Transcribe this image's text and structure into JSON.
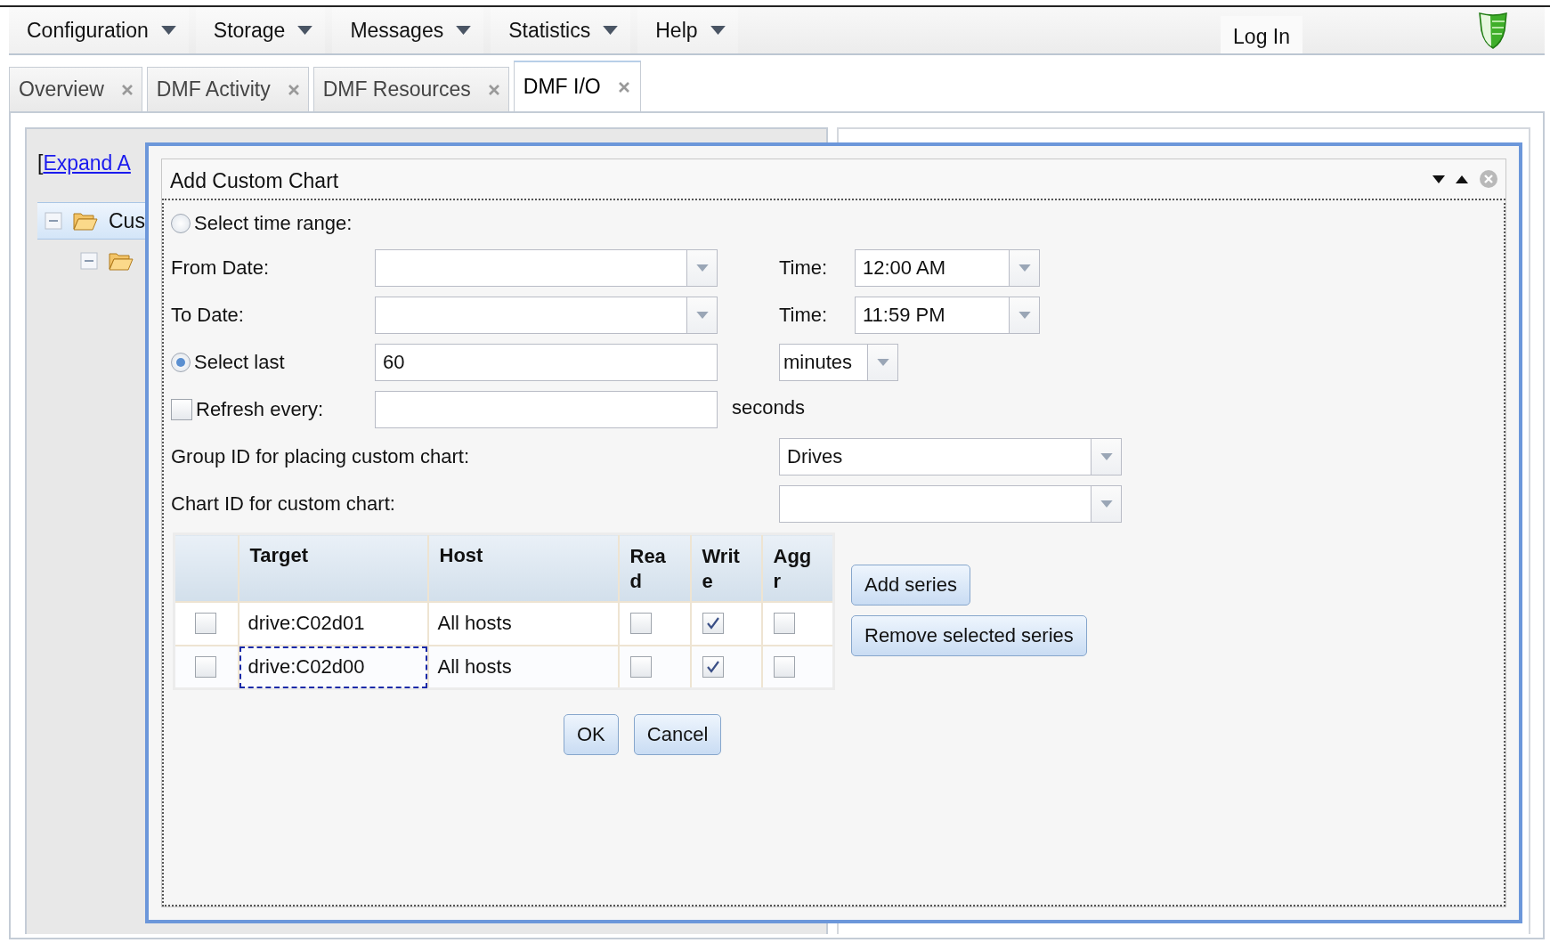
{
  "menubar": {
    "menus": [
      {
        "label": "Configuration"
      },
      {
        "label": "Storage"
      },
      {
        "label": "Messages"
      },
      {
        "label": "Statistics"
      },
      {
        "label": "Help"
      }
    ],
    "login": "Log In"
  },
  "tabs": [
    {
      "label": "Overview",
      "selected": false
    },
    {
      "label": "DMF Activity",
      "selected": false
    },
    {
      "label": "DMF Resources",
      "selected": false
    },
    {
      "label": "DMF I/O",
      "selected": true
    }
  ],
  "left_panel": {
    "bracket": "[",
    "expand_link": "Expand A",
    "tree": [
      {
        "label": "Cus",
        "expanded": true,
        "selected": true,
        "children": [
          {
            "expanded": true,
            "selected": false
          }
        ]
      }
    ]
  },
  "dialog": {
    "title": "Add Custom Chart",
    "time_range": {
      "label": "Select time range:",
      "selected": false
    },
    "from_date": {
      "label": "From Date:",
      "time_label": "Time:",
      "time": "12:00 AM"
    },
    "to_date": {
      "label": "To Date:",
      "time_label": "Time:",
      "time": "11:59 PM"
    },
    "select_last": {
      "label": "Select last",
      "selected": true,
      "value": "60",
      "unit": "minutes"
    },
    "refresh": {
      "label": "Refresh every:",
      "checked": false,
      "suffix": "seconds"
    },
    "group_id": {
      "label": "Group ID for placing custom chart:",
      "value": "Drives"
    },
    "chart_id": {
      "label": "Chart ID for custom chart:"
    },
    "series_table": {
      "columns": [
        "Target",
        "Host",
        "Read",
        "Write",
        "Aggr"
      ],
      "rows": [
        {
          "selected": false,
          "target": "drive:C02d01",
          "host": "All hosts",
          "read": false,
          "write": true,
          "aggr": false,
          "focused": false
        },
        {
          "selected": false,
          "target": "drive:C02d00",
          "host": "All hosts",
          "read": false,
          "write": true,
          "aggr": false,
          "focused": true
        }
      ]
    },
    "add_series": "Add series",
    "remove_series": "Remove selected series",
    "ok": "OK",
    "cancel": "Cancel"
  }
}
